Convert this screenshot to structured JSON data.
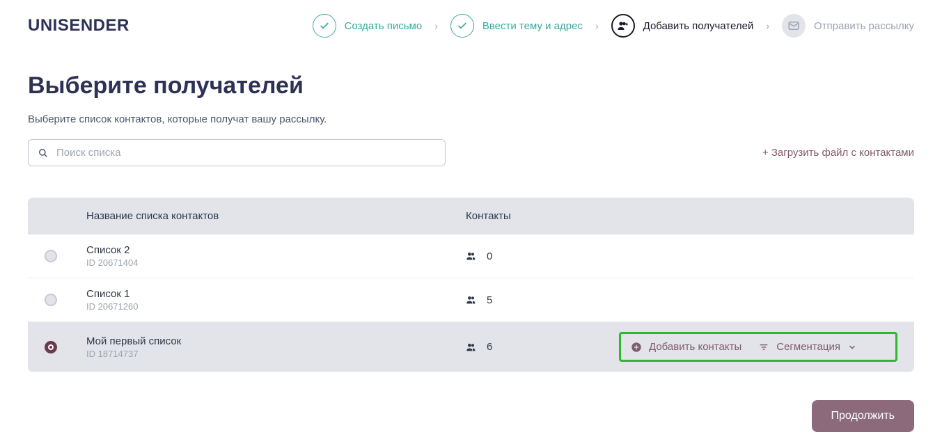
{
  "logo": "UNISENDER",
  "steps": [
    {
      "label": "Создать письмо",
      "state": "done"
    },
    {
      "label": "Ввести тему и адрес",
      "state": "done"
    },
    {
      "label": "Добавить получателей",
      "state": "current"
    },
    {
      "label": "Отправить рассылку",
      "state": "disabled"
    }
  ],
  "page": {
    "title": "Выберите получателей",
    "subtitle": "Выберите список контактов, которые получат вашу рассылку."
  },
  "search": {
    "placeholder": "Поиск списка"
  },
  "upload_link": "+ Загрузить файл с контактами",
  "table": {
    "headers": {
      "name": "Название списка контактов",
      "contacts": "Контакты"
    },
    "rows": [
      {
        "name": "Список 2",
        "id": "ID 20671404",
        "contacts": "0",
        "selected": false
      },
      {
        "name": "Список 1",
        "id": "ID 20671260",
        "contacts": "5",
        "selected": false
      },
      {
        "name": "Мой первый список",
        "id": "ID 18714737",
        "contacts": "6",
        "selected": true
      }
    ]
  },
  "actions": {
    "add_contacts": "Добавить контакты",
    "segmentation": "Сегментация"
  },
  "continue_label": "Продолжить"
}
